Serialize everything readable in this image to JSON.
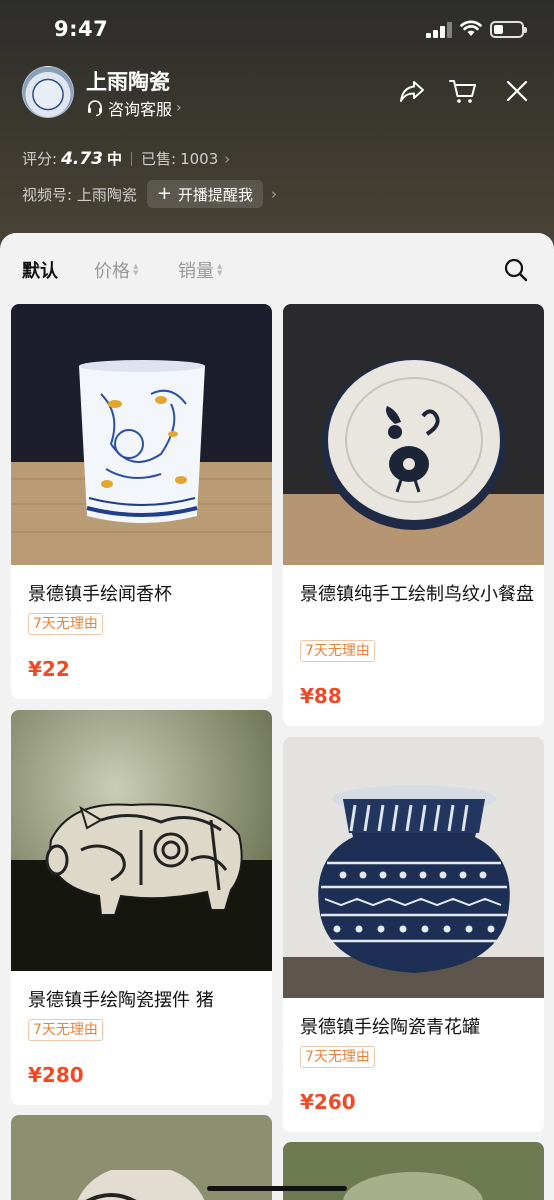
{
  "status_bar": {
    "time": "9:47"
  },
  "shop": {
    "name": "上雨陶瓷",
    "service_label": "咨询客服",
    "score_label": "评分:",
    "score": "4.73",
    "level": "中",
    "sold_label": "已售:",
    "sold_count": "1003",
    "video_label": "视频号: 上雨陶瓷",
    "live_reminder": "开播提醒我"
  },
  "sort": {
    "default": "默认",
    "price": "价格",
    "sales": "销量"
  },
  "products": [
    {
      "title": "景德镇手绘闻香杯",
      "tag": "7天无理由",
      "price": "¥22"
    },
    {
      "title": "景德镇纯手工绘制鸟纹小餐盘",
      "tag": "7天无理由",
      "price": "¥88"
    },
    {
      "title": "景德镇手绘陶瓷摆件 猪",
      "tag": "7天无理由",
      "price": "¥280"
    },
    {
      "title": "景德镇手绘陶瓷青花罐",
      "tag": "7天无理由",
      "price": "¥260"
    }
  ],
  "colors": {
    "price": "#f04a26",
    "tag": "#e8833a",
    "header_bg": "#3a372f"
  },
  "icons": [
    "share-icon",
    "cart-icon",
    "close-icon",
    "headset-icon",
    "search-icon"
  ]
}
